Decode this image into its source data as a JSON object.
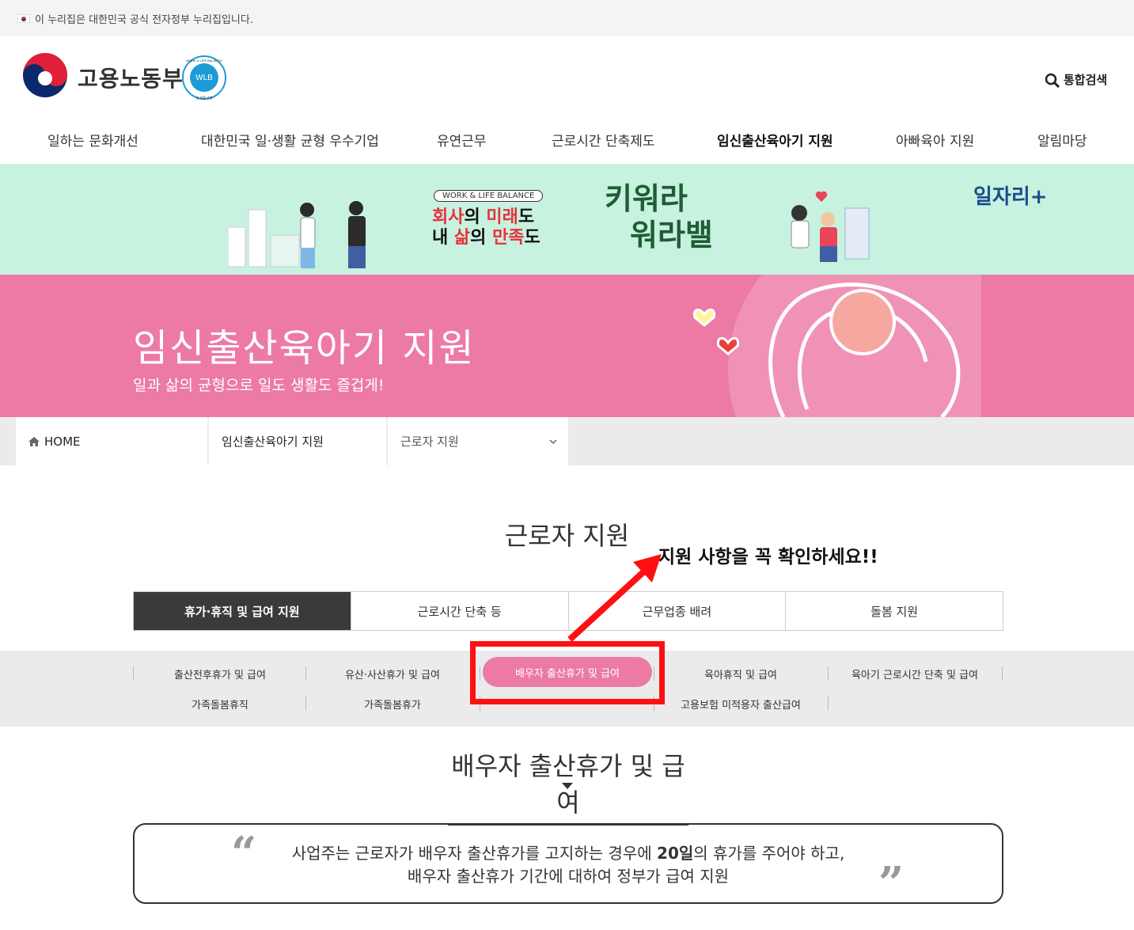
{
  "gov_notice": "이 누리집은 대한민국 공식 전자정부 누리집입니다.",
  "header": {
    "logo_text": "고용노동부",
    "badge_ring_text": "WORK & LIFE BALANCE",
    "badge_center": "WLB",
    "badge_bottom": "일·생활 균형",
    "search_label": "통합검색"
  },
  "gnb": [
    {
      "label": "일하는 문화개선",
      "active": false
    },
    {
      "label": "대한민국 일·생활 균형 우수기업",
      "active": false
    },
    {
      "label": "유연근무",
      "active": false
    },
    {
      "label": "근로시간 단축제도",
      "active": false
    },
    {
      "label": "임신출산육아기 지원",
      "active": true
    },
    {
      "label": "아빠육아 지원",
      "active": false
    },
    {
      "label": "알림마당",
      "active": false
    }
  ],
  "banner": {
    "tag": "WORK & LIFE BALANCE",
    "slogan_line1_a": "회사",
    "slogan_line1_b": "의 ",
    "slogan_line1_c": "미래",
    "slogan_line1_d": "도",
    "slogan_line2_a": "내 ",
    "slogan_line2_b": "삶",
    "slogan_line2_c": "의 ",
    "slogan_line2_d": "만족",
    "slogan_line2_e": "도",
    "kiwo_line1": "키워라",
    "kiwo_line2": "워라밸",
    "jobplus": "일자리+"
  },
  "hero": {
    "title": "임신출산육아기 지원",
    "subtitle": "일과 삶의 균형으로 일도 생활도 즐겁게!"
  },
  "breadcrumb": {
    "home": "HOME",
    "level1": "임신출산육아기 지원",
    "level2": "근로자 지원"
  },
  "section": {
    "title": "근로자 지원",
    "annotation": "지원 사항을 꼭 확인하세요!!"
  },
  "tabs": [
    {
      "label": "휴가·휴직 및 급여 지원",
      "active": true
    },
    {
      "label": "근로시간 단축 등",
      "active": false
    },
    {
      "label": "근무업종 배려",
      "active": false
    },
    {
      "label": "돌봄 지원",
      "active": false
    }
  ],
  "subtabs": {
    "row1": [
      "출산전후휴가 및 급여",
      "유산·사산휴가 및 급여",
      "배우자 출산휴가 및 급여",
      "육아휴직 및 급여",
      "육아기 근로시간 단축 및 급여"
    ],
    "row2": [
      "가족돌봄휴직",
      "가족돌봄휴가",
      "",
      "고용보험 미적용자 출산급여"
    ],
    "active": "배우자 출산휴가 및 급여"
  },
  "content": {
    "title": "배우자 출산휴가 및 급여",
    "quote_line1_pre": "사업주는 근로자가 배우자 출산휴가를 고지하는 경우에 ",
    "quote_line1_bold": "20일",
    "quote_line1_post": "의 휴가를 주어야 하고,",
    "quote_line2": "배우자 출산휴가 기간에 대하여 정부가 급여 지원"
  },
  "colors": {
    "pink": "#ec7aa5",
    "mint": "#c7f2df",
    "annotation_red": "#ff1010",
    "tab_active": "#3a3a3a"
  }
}
